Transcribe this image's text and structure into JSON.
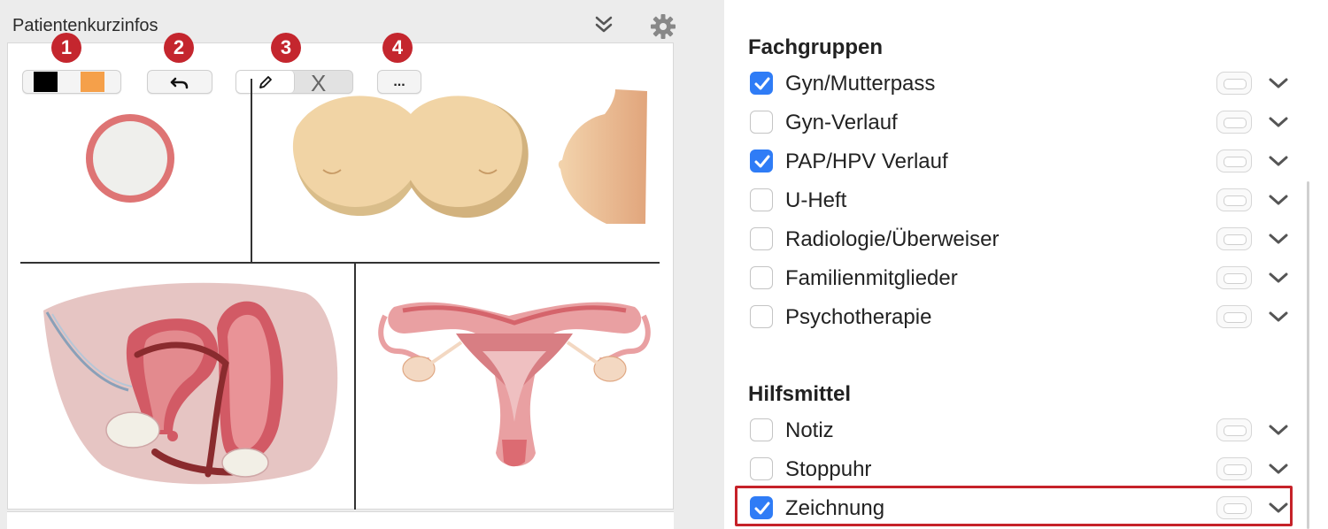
{
  "left_panel": {
    "title": "Patientenkurzinfos",
    "badges": [
      "1",
      "2",
      "3",
      "4"
    ],
    "tools": {
      "colors": [
        "#000000",
        "#f5a04a"
      ],
      "undo_icon": "undo-icon",
      "pencil_icon": "pencil-icon",
      "clear_label": "X",
      "more_label": "..."
    }
  },
  "right_panel": {
    "sections": [
      {
        "heading": "Fachgruppen",
        "items": [
          {
            "label": "Gyn/Mutterpass",
            "checked": true
          },
          {
            "label": "Gyn-Verlauf",
            "checked": false
          },
          {
            "label": "PAP/HPV Verlauf",
            "checked": true
          },
          {
            "label": "U-Heft",
            "checked": false
          },
          {
            "label": "Radiologie/Überweiser",
            "checked": false
          },
          {
            "label": "Familienmitglieder",
            "checked": false
          },
          {
            "label": "Psychotherapie",
            "checked": false
          }
        ]
      },
      {
        "heading": "Hilfsmittel",
        "items": [
          {
            "label": "Notiz",
            "checked": false
          },
          {
            "label": "Stoppuhr",
            "checked": false
          },
          {
            "label": "Zeichnung",
            "checked": true
          }
        ]
      }
    ]
  },
  "colors": {
    "accent_blue": "#2f7cf6",
    "badge_red": "#c4262e",
    "highlight_red": "#c62229"
  }
}
